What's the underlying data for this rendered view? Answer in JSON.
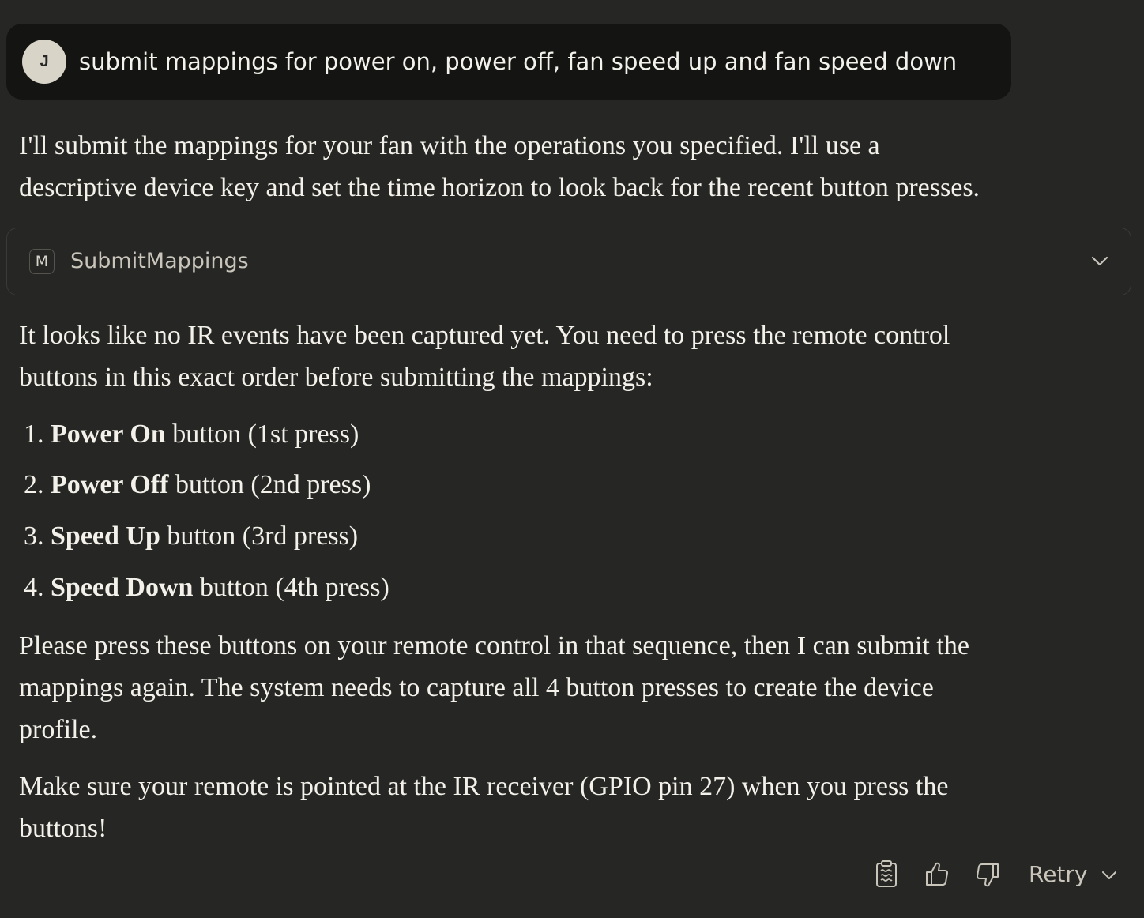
{
  "user_message": {
    "avatar_initial": "J",
    "text": "submit mappings for power on, power off, fan speed up and fan speed down"
  },
  "assistant": {
    "intro_line1": "I'll submit the mappings for your fan with the operations you specified. I'll use a",
    "intro_line2": "descriptive device key and set the time horizon to look back for the recent button presses.",
    "tool": {
      "badge": "M",
      "name": "SubmitMappings"
    },
    "para2_line1": "It looks like no IR events have been captured yet. You need to press the remote control",
    "para2_line2": "buttons in this exact order before submitting the mappings:",
    "steps": [
      {
        "num": "1.",
        "bold": "Power On",
        "rest": " button (1st press)"
      },
      {
        "num": "2.",
        "bold": "Power Off",
        "rest": " button (2nd press)"
      },
      {
        "num": "3.",
        "bold": "Speed Up",
        "rest": " button (3rd press)"
      },
      {
        "num": "4.",
        "bold": "Speed Down",
        "rest": " button (4th press)"
      }
    ],
    "para3_line1": "Please press these buttons on your remote control in that sequence, then I can submit the",
    "para3_line2": "mappings again. The system needs to capture all 4 button presses to create the device",
    "para3_line3": "profile.",
    "para4_line1": "Make sure your remote is pointed at the IR receiver (GPIO pin 27) when you press the",
    "para4_line2": "buttons!"
  },
  "actions": {
    "copy_icon": "clipboard-icon",
    "like_icon": "thumbs-up-icon",
    "dislike_icon": "thumbs-down-icon",
    "retry_label": "Retry"
  }
}
